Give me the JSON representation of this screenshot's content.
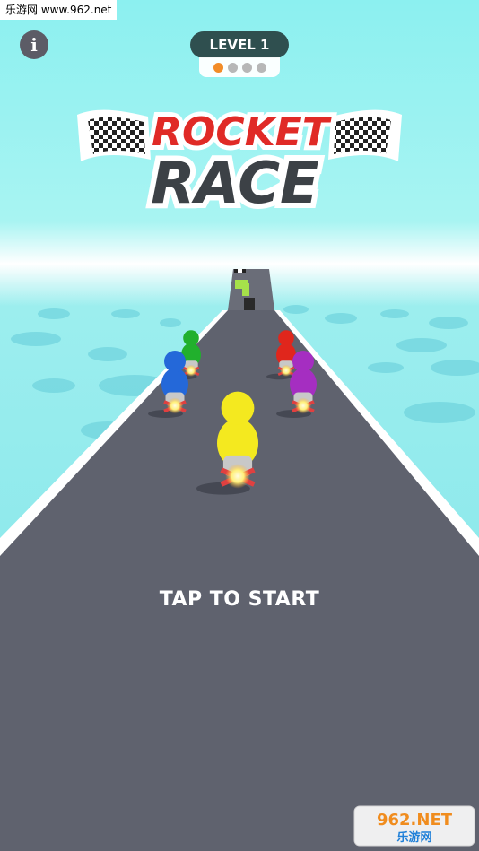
{
  "watermark": {
    "text": "乐游网 www.962.net"
  },
  "header": {
    "info_glyph": "i",
    "level_label": "LEVEL 1",
    "progress": {
      "current": 1,
      "total": 4
    }
  },
  "logo": {
    "line1": "ROCKET",
    "line2": "RACE"
  },
  "prompt": {
    "tap_to_start": "TAP TO START"
  },
  "badge": {
    "line1": "962.NET",
    "line2": "乐游网"
  },
  "colors": {
    "sky": "#8ff0ef",
    "road": "#5f626e",
    "level_pill": "#2f4f4f",
    "active_dot": "#f28c28",
    "logo_red": "#e02a26",
    "logo_dark": "#3c4146",
    "riders": [
      "#f4e91f",
      "#2468d9",
      "#21b02d",
      "#e0261c",
      "#a52ec1"
    ]
  }
}
